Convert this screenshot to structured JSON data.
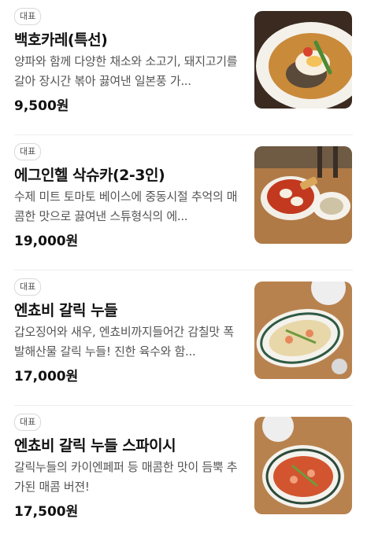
{
  "menu": {
    "items": [
      {
        "badge": "대표",
        "name": "백호카레(특선)",
        "description": "양파와 함께 다양한 채소와 소고기, 돼지고기를 갈아 장시간 볶아 끓여낸 일본풍 가...",
        "price": "9,500원",
        "image": "curry-photo"
      },
      {
        "badge": "대표",
        "name": "에그인헬 삭슈카(2-3인)",
        "description": "수제 미트 토마토 베이스에 중동시절 추억의 매콤한 맛으로 끓여낸 스튜형식의 에...",
        "price": "19,000원",
        "image": "shakshuka-photo"
      },
      {
        "badge": "대표",
        "name": "엔쵸비 갈릭 누들",
        "description": "갑오징어와 새우, 엔쵸비까지들어간 감칠맛 폭발해산물 갈릭 누들! 진한 육수와 함...",
        "price": "17,000원",
        "image": "anchovy-garlic-noodle-photo"
      },
      {
        "badge": "대표",
        "name": "엔쵸비 갈릭 누들 스파이시",
        "description": "갈릭누들의 카이엔페퍼 등 매콤한 맛이 듬뿍 추가된 매콤 버젼!",
        "price": "17,500원",
        "image": "spicy-anchovy-noodle-photo"
      }
    ]
  }
}
